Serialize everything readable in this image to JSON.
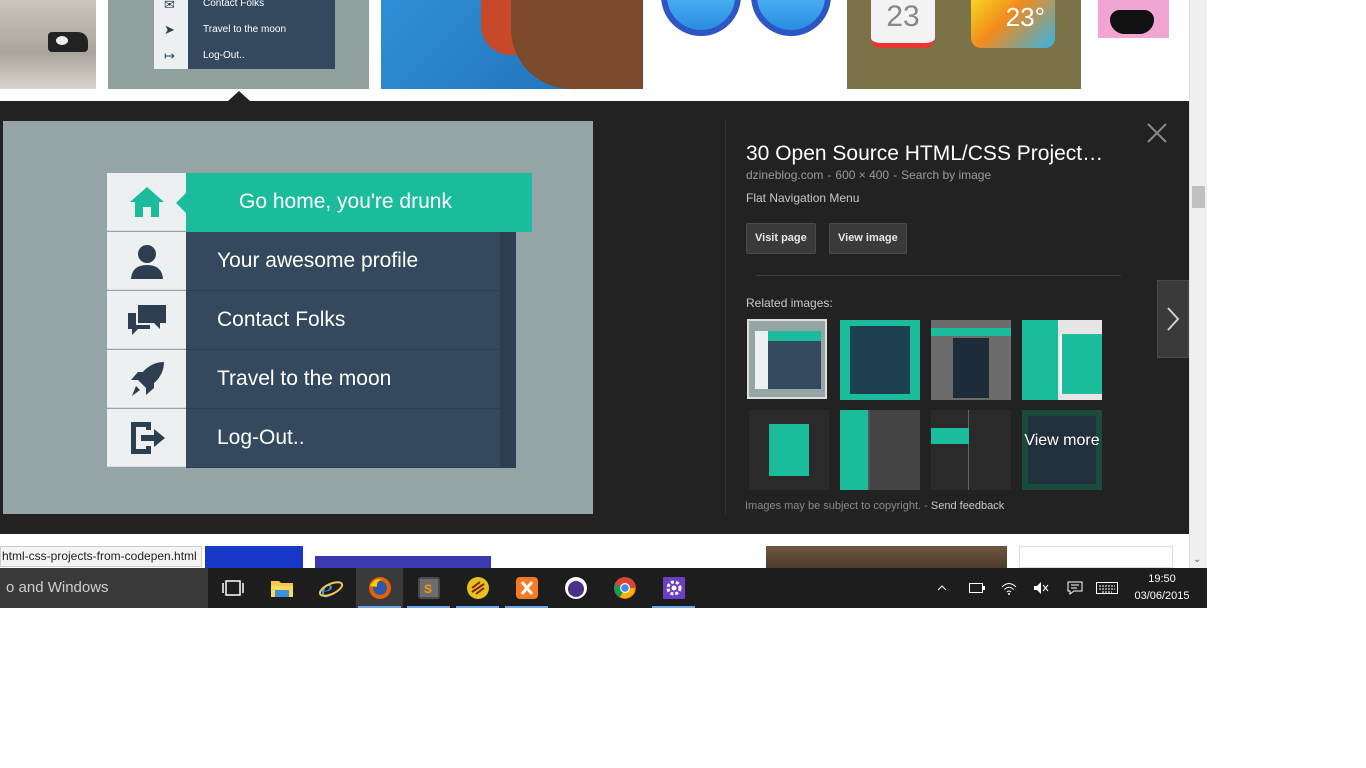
{
  "top_thumbs": {
    "mini_menu": [
      "Contact Folks",
      "Travel to the moon",
      "Log-Out.."
    ],
    "calendar_day": "23",
    "weather_temp": "23°"
  },
  "preview": {
    "menu_items": [
      {
        "label": "Go home, you're drunk",
        "icon": "home-icon",
        "active": true
      },
      {
        "label": "Your awesome profile",
        "icon": "user-icon",
        "active": false
      },
      {
        "label": "Contact Folks",
        "icon": "chat-icon",
        "active": false
      },
      {
        "label": "Travel to the moon",
        "icon": "rocket-icon",
        "active": false
      },
      {
        "label": "Log-Out..",
        "icon": "logout-icon",
        "active": false
      }
    ],
    "title": "30 Open Source HTML/CSS Project…",
    "source": "dzineblog.com",
    "dimensions": "600 × 400",
    "search_by_image": "Search by image",
    "description": "Flat Navigation Menu",
    "visit_page": "Visit page",
    "view_image": "View image",
    "related_label": "Related images:",
    "view_more": "View more",
    "copyright": "Images may be subject to copyright.",
    "send_feedback": "Send feedback",
    "sep": "-"
  },
  "status_url": "html-css-projects-from-codepen.html",
  "taskbar": {
    "search_text": "o and Windows",
    "time": "19:50",
    "date": "03/06/2015"
  },
  "colors": {
    "accent": "#1abc9c",
    "menu_dark": "#34495e",
    "preview_bg": "#222222"
  }
}
